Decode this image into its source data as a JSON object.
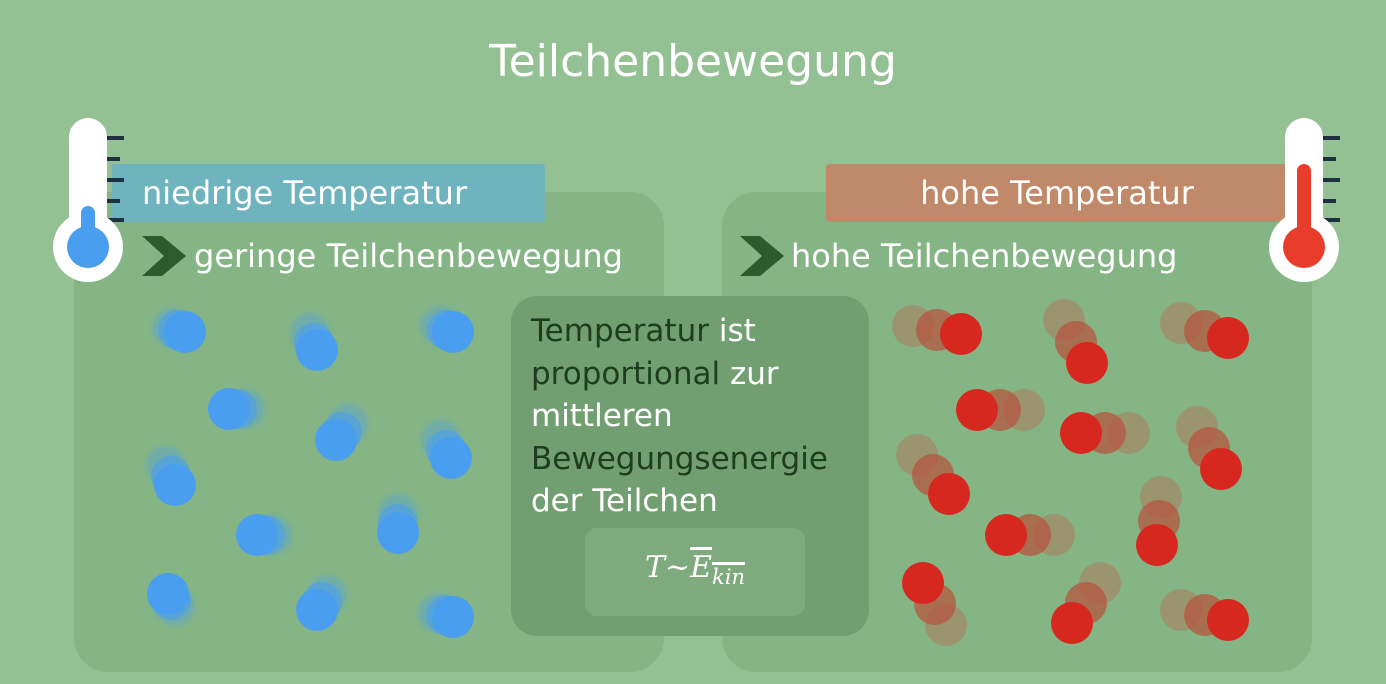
{
  "title": "Teilchenbewegung",
  "left": {
    "label": "niedrige Temperatur",
    "subtitle": "geringe Teilchenbewegung",
    "color": "#4a9ef0"
  },
  "right": {
    "label": "hohe Temperatur",
    "subtitle": "hohe Teilchenbewegung",
    "color": "#d6281e"
  },
  "center": {
    "word1": "Temperatur",
    "word2": " ist",
    "word3": "proportional",
    "word4": " zur",
    "line3": "mittleren",
    "line4": "Bewegungsenergie",
    "line5": "der Teilchen",
    "formula_lhs": "T",
    "formula_op": "~",
    "formula_E": "E",
    "formula_sub": "kin"
  },
  "icons": [
    "thermometer-cold-icon",
    "thermometer-hot-icon",
    "chevron-right-icon"
  ]
}
